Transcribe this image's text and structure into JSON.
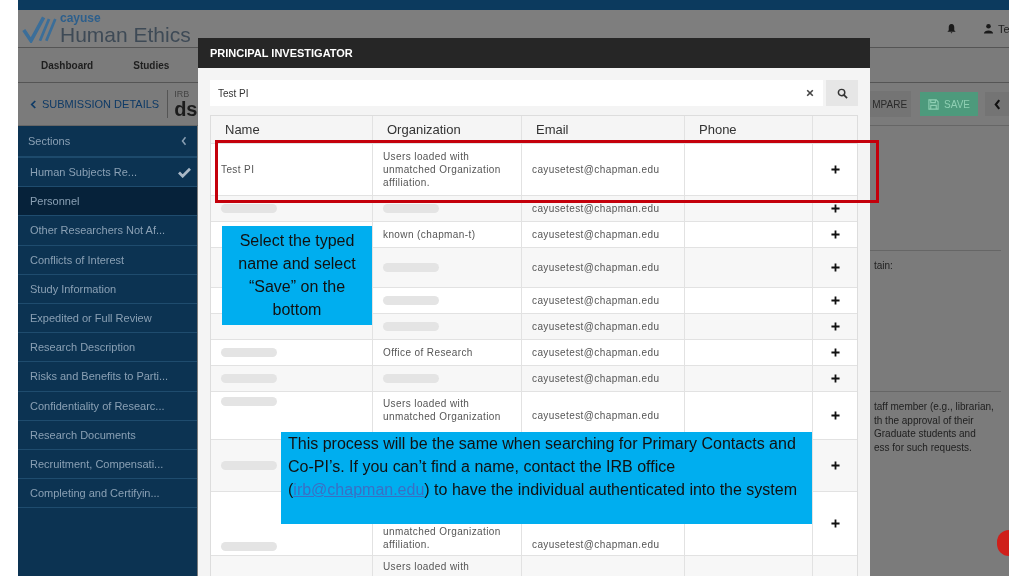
{
  "header": {
    "logo_small": "cayuse",
    "logo_large": "Human Ethics",
    "user": "Te"
  },
  "nav": [
    "Dashboard",
    "Studies"
  ],
  "subheader": {
    "back": "SUBMISSION DETAILS",
    "irb_label": "IRB",
    "title": "ds",
    "compare": "MPARE",
    "save": "SAVE"
  },
  "sidebar": {
    "title": "Sections",
    "items": [
      {
        "label": "Human Subjects Re...",
        "checked": true,
        "selected": false
      },
      {
        "label": "Personnel",
        "checked": false,
        "selected": true
      },
      {
        "label": "Other Researchers Not Af...",
        "checked": false,
        "selected": false
      },
      {
        "label": "Conflicts of Interest",
        "checked": false,
        "selected": false
      },
      {
        "label": "Study Information",
        "checked": false,
        "selected": false
      },
      {
        "label": "Expedited or Full Review",
        "checked": false,
        "selected": false
      },
      {
        "label": "Research Description",
        "checked": false,
        "selected": false
      },
      {
        "label": "Risks and Benefits to Parti...",
        "checked": false,
        "selected": false
      },
      {
        "label": "Confidentiality of Researc...",
        "checked": false,
        "selected": false
      },
      {
        "label": "Research Documents",
        "checked": false,
        "selected": false
      },
      {
        "label": "Recruitment, Compensati...",
        "checked": false,
        "selected": false
      },
      {
        "label": "Completing and Certifyin...",
        "checked": false,
        "selected": false
      }
    ]
  },
  "content": {
    "label": "tain:",
    "paragraph_lines": [
      "taff member (e.g., librarian,",
      "th the approval of their",
      "Graduate students and",
      "ess for such requests."
    ]
  },
  "modal": {
    "title": "PRINCIPAL INVESTIGATOR",
    "search": {
      "value": "Test PI"
    },
    "table": {
      "columns": [
        "Name",
        "Organization",
        "Email",
        "Phone"
      ],
      "rows": [
        {
          "kind": "tall",
          "cells": [
            {
              "kind": "text",
              "text": "Test PI"
            },
            {
              "kind": "text",
              "text": "Users loaded with unmatched Organization affiliation."
            },
            {
              "kind": "text",
              "text": "cayusetest@chapman.edu"
            },
            {
              "kind": "blank"
            }
          ]
        },
        {
          "kind": "short",
          "cells": [
            {
              "kind": "redacted"
            },
            {
              "kind": "redacted"
            },
            {
              "kind": "text",
              "text": "cayusetest@chapman.edu"
            },
            {
              "kind": "blank"
            }
          ]
        },
        {
          "kind": "short",
          "cells": [
            {
              "kind": "blank"
            },
            {
              "kind": "text",
              "text": "known (chapman-t)"
            },
            {
              "kind": "text",
              "text": "cayusetest@chapman.edu"
            },
            {
              "kind": "blank"
            }
          ]
        },
        {
          "kind": "medium",
          "cells": [
            {
              "kind": "blank"
            },
            {
              "kind": "redacted"
            },
            {
              "kind": "text",
              "text": "cayusetest@chapman.edu"
            },
            {
              "kind": "blank"
            }
          ]
        },
        {
          "kind": "short",
          "cells": [
            {
              "kind": "blank"
            },
            {
              "kind": "redacted"
            },
            {
              "kind": "text",
              "text": "cayusetest@chapman.edu"
            },
            {
              "kind": "blank"
            }
          ]
        },
        {
          "kind": "short",
          "cells": [
            {
              "kind": "blank"
            },
            {
              "kind": "redacted"
            },
            {
              "kind": "text",
              "text": "cayusetest@chapman.edu"
            },
            {
              "kind": "blank"
            }
          ]
        },
        {
          "kind": "short",
          "cells": [
            {
              "kind": "redacted"
            },
            {
              "kind": "text",
              "text": "Office of Research"
            },
            {
              "kind": "text",
              "text": "cayusetest@chapman.edu"
            },
            {
              "kind": "blank"
            }
          ]
        },
        {
          "kind": "short",
          "cells": [
            {
              "kind": "redacted"
            },
            {
              "kind": "redacted"
            },
            {
              "kind": "text",
              "text": "cayusetest@chapman.edu"
            },
            {
              "kind": "blank"
            }
          ]
        },
        {
          "kind": "tall-top",
          "cells": [
            {
              "kind": "redacted"
            },
            {
              "kind": "text",
              "text": "Users loaded with unmatched Organization"
            },
            {
              "kind": "text",
              "text": "cayusetest@chapman.edu"
            },
            {
              "kind": "blank"
            }
          ]
        },
        {
          "kind": "covered",
          "cells": [
            {
              "kind": "redacted"
            },
            {
              "kind": "blank"
            },
            {
              "kind": "blank"
            },
            {
              "kind": "blank"
            }
          ]
        },
        {
          "kind": "tall-bottom",
          "cells": [
            {
              "kind": "redacted"
            },
            {
              "kind": "text",
              "text": "unmatched Organization affiliation."
            },
            {
              "kind": "text",
              "text": "cayusetest@chapman.edu"
            },
            {
              "kind": "blank"
            }
          ]
        },
        {
          "kind": "cut",
          "cells": [
            {
              "kind": "blank"
            },
            {
              "kind": "text",
              "text": "Users loaded with"
            },
            {
              "kind": "blank"
            },
            {
              "kind": "blank"
            }
          ]
        }
      ]
    }
  },
  "callouts": [
    {
      "kind": "small",
      "text": "Select the typed name and select “Save” on the bottom"
    },
    {
      "kind": "wide",
      "text": "This process will be the same when searching for Primary Contacts and Co-PI’s.  If you can’t find a name, contact the IRB office (",
      "link": "irb@chapman.edu",
      "text_after": ") to have the individual authenticated into the system"
    }
  ]
}
